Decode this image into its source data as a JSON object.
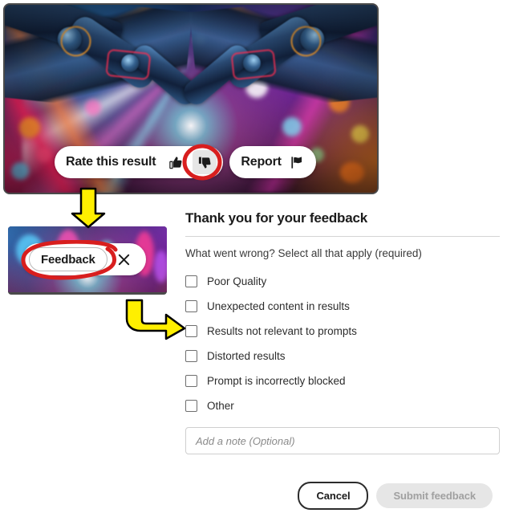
{
  "result_image": {
    "alt": "ai-generated-robot-arms-neon-lights",
    "description": "Two robotic arms reaching toward each other over a neon-lit city bokeh background"
  },
  "rate_toolbar": {
    "rate_label": "Rate this result",
    "thumbs_up_icon": "thumbs-up-icon",
    "thumbs_down_icon": "thumbs-down-icon",
    "thumbs_down_selected": true,
    "report_label": "Report",
    "report_icon": "flag-icon"
  },
  "feedback_bar": {
    "chip_label": "Feedback",
    "close_icon": "close-icon"
  },
  "feedback_form": {
    "title": "Thank you for your feedback",
    "question": "What went wrong? Select all that apply (required)",
    "options": [
      {
        "label": "Poor Quality",
        "checked": false
      },
      {
        "label": "Unexpected content in results",
        "checked": false
      },
      {
        "label": "Results not relevant to prompts",
        "checked": false
      },
      {
        "label": "Distorted results",
        "checked": false
      },
      {
        "label": "Prompt is incorrectly blocked",
        "checked": false
      },
      {
        "label": "Other",
        "checked": false
      }
    ],
    "note": {
      "value": "",
      "placeholder": "Add a note (Optional)"
    },
    "cancel_label": "Cancel",
    "submit_label": "Submit feedback",
    "submit_disabled": true
  },
  "annotations": {
    "highlight_color": "#d81e1e",
    "arrow_color": "#ffef00",
    "arrow_outline_color": "#000000",
    "items": [
      {
        "name": "thumbs-down-highlight",
        "type": "ellipse"
      },
      {
        "name": "feedback-chip-highlight",
        "type": "ellipse"
      },
      {
        "name": "flow-arrow-down",
        "type": "arrow"
      },
      {
        "name": "flow-arrow-right",
        "type": "arrow"
      }
    ]
  }
}
